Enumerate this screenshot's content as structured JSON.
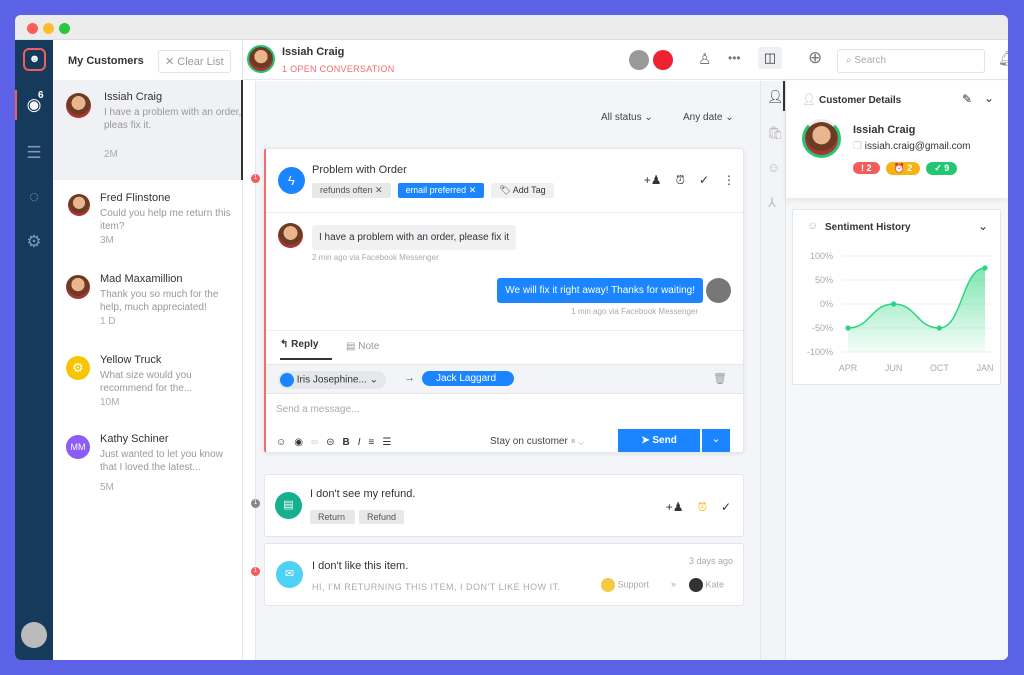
{
  "sidebar": {
    "notification_count": "6"
  },
  "customer_list": {
    "title": "My Customers",
    "clear_label": "Clear List",
    "items": [
      {
        "name": "Issiah Craig",
        "preview": "I have a problem with an order, pleas fix it.",
        "time": "2M"
      },
      {
        "name": "Fred Flinstone",
        "preview": "Could you help me return this item?",
        "time": "3M"
      },
      {
        "name": "Mad Maxamillion",
        "preview": "Thank you so much for the help, much appreciated!",
        "time": "1 D"
      },
      {
        "name": "Yellow Truck",
        "preview": "What size would you recommend for the...",
        "time": "10M"
      },
      {
        "name": "Kathy Schiner",
        "initials": "MM",
        "preview": "Just wanted to let you know that I loved the latest...",
        "time": "5M"
      }
    ]
  },
  "header": {
    "name": "Issiah Craig",
    "status": "1 OPEN CONVERSATION",
    "search_placeholder": "Search"
  },
  "filters": {
    "status": "All status",
    "date": "Any date"
  },
  "conversation": {
    "title": "Problem with Order",
    "tags": [
      "refunds often",
      "email preferred"
    ],
    "add_tag": "Add Tag",
    "messages": [
      {
        "text": "I have a problem with an order, please fix it",
        "meta": "2 min ago via Facebook Messenger"
      },
      {
        "text": "We will fix it right away! Thanks for waiting!",
        "meta": "1 min ago via Facebook Messenger"
      }
    ],
    "tabs": {
      "reply": "Reply",
      "note": "Note"
    },
    "from": "Iris Josephine...",
    "to": "Jack Laggard",
    "message_placeholder": "Send a message...",
    "stay_label": "Stay on customer",
    "send_label": "Send"
  },
  "conversation2": {
    "title": "I don't see my refund.",
    "tags": [
      "Return",
      "Refund"
    ]
  },
  "conversation3": {
    "title": "I don't like this item.",
    "preview": "HI, I'M RETURNING THIS ITEM, I DON'T LIKE HOW IT.",
    "time": "3 days ago",
    "team": "Support",
    "assignee": "Kate"
  },
  "customer_details": {
    "title": "Customer Details",
    "name": "Issiah Craig",
    "email": "issiah.craig@gmail.com",
    "counts": [
      {
        "label": "! 2",
        "color": "#f25c5c"
      },
      {
        "label": "⏰ 2",
        "color": "#f5b316"
      },
      {
        "label": "✓ 9",
        "color": "#22c773"
      }
    ]
  },
  "sentiment": {
    "title": "Sentiment History"
  },
  "chart_data": {
    "type": "area",
    "x": [
      "APR",
      "JUN",
      "OCT",
      "JAN"
    ],
    "values": [
      -50,
      0,
      -50,
      75
    ],
    "yticks": [
      "100%",
      "50%",
      "0%",
      "-50%",
      "-100%"
    ],
    "ylim": [
      -100,
      100
    ],
    "grid": true,
    "color": "#2bd47f"
  }
}
